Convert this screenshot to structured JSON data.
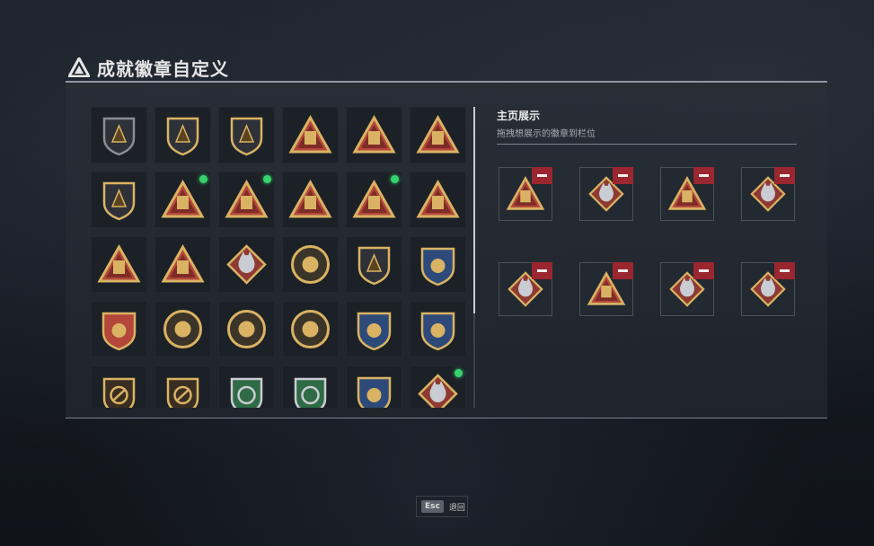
{
  "page": {
    "title": "成就徽章自定义"
  },
  "showcase": {
    "title": "主页展示",
    "subtitle": "拖拽想展示的徽章到栏位",
    "slots": [
      {
        "icon": "tower-gold-icon"
      },
      {
        "icon": "dog-head-red-icon"
      },
      {
        "icon": "medal-burst-gold-icon"
      },
      {
        "icon": "wolf-head-red-icon"
      },
      {
        "icon": "wolf-head-red-icon"
      },
      {
        "icon": "crate-gold-icon"
      },
      {
        "icon": "dragon-head-red-icon"
      },
      {
        "icon": "wolf-head-red-icon"
      }
    ]
  },
  "badges": [
    {
      "icon": "shield-emblem-icon",
      "new": false
    },
    {
      "icon": "helicopter-badge-icon",
      "new": false
    },
    {
      "icon": "arrow-shield-badge-icon",
      "new": false
    },
    {
      "icon": "mask-triangle-badge-icon",
      "new": false
    },
    {
      "icon": "crate-triangle-badge-icon",
      "new": false
    },
    {
      "icon": "tower-triangle-badge-icon",
      "new": false
    },
    {
      "icon": "canister-58-badge-icon",
      "new": false
    },
    {
      "icon": "skull-triangle-badge-icon",
      "new": true
    },
    {
      "icon": "burst-triangle-badge-icon",
      "new": true
    },
    {
      "icon": "number-1-triangle-badge-icon",
      "new": false
    },
    {
      "icon": "battery-triangle-badge-icon",
      "new": true
    },
    {
      "icon": "flame-triangle-badge-icon",
      "new": false
    },
    {
      "icon": "soldiers-triangle-badge-icon",
      "new": false
    },
    {
      "icon": "rocket-triangle-badge-icon",
      "new": false
    },
    {
      "icon": "flower-diamond-badge-icon",
      "new": false
    },
    {
      "icon": "star-circle-badge-icon",
      "new": false
    },
    {
      "icon": "chevron-shield-badge-icon",
      "new": false
    },
    {
      "icon": "star-crest-badge-icon",
      "new": false
    },
    {
      "icon": "crest-red-badge-icon",
      "new": false
    },
    {
      "icon": "skull-circle-badge-icon",
      "new": false
    },
    {
      "icon": "skull-wreath-badge-icon",
      "new": false
    },
    {
      "icon": "sun-circle-badge-icon",
      "new": false
    },
    {
      "icon": "crossed-guns-badge-icon",
      "new": false
    },
    {
      "icon": "crosshair-shield-badge-icon",
      "new": false
    },
    {
      "icon": "no-entry-shield-badge-icon",
      "new": false
    },
    {
      "icon": "rifle-shield-badge-icon",
      "new": false
    },
    {
      "icon": "recycle-green-badge-icon",
      "new": false
    },
    {
      "icon": "ammo-green-badge-icon",
      "new": false
    },
    {
      "icon": "gun-cross-badge-icon",
      "new": false
    },
    {
      "icon": "wolf-diamond-badge-icon",
      "new": true
    }
  ],
  "footer": {
    "esc_key": "Esc",
    "esc_label": "退回"
  }
}
